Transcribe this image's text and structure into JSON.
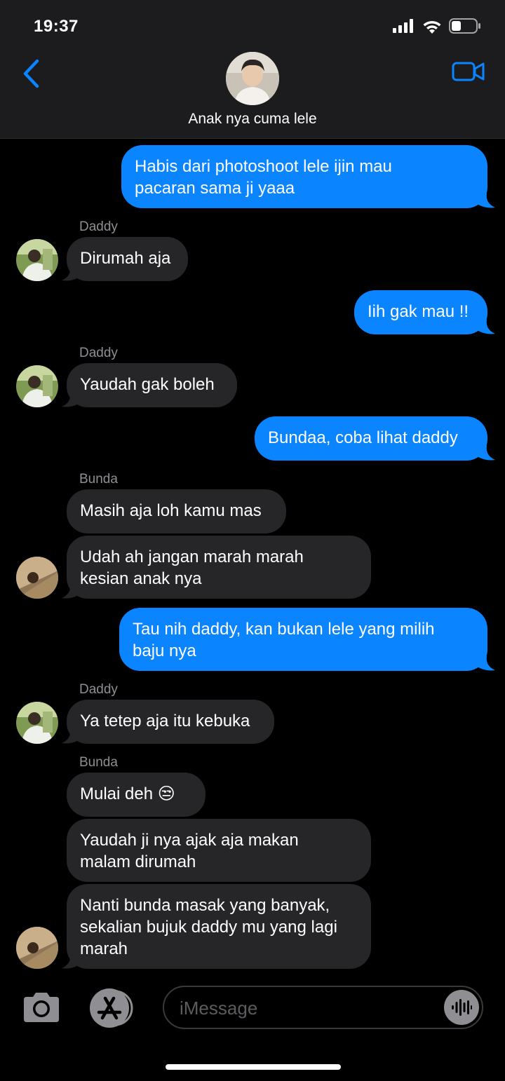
{
  "status_bar": {
    "time": "19:37"
  },
  "header": {
    "contact_name": "Anak nya cuma lele"
  },
  "messages": [
    {
      "id": "m1",
      "direction": "out",
      "text_lines": [
        "Habis dari photoshoot lele ijin mau",
        "pacaran sama ji yaaa"
      ]
    },
    {
      "id": "m2",
      "direction": "in",
      "sender": "Daddy",
      "text_lines": [
        "Dirumah aja"
      ]
    },
    {
      "id": "m3",
      "direction": "out",
      "text_lines": [
        "Iih gak mau !!"
      ]
    },
    {
      "id": "m4",
      "direction": "in",
      "sender": "Daddy",
      "text_lines": [
        "Yaudah gak boleh"
      ]
    },
    {
      "id": "m5",
      "direction": "out",
      "text_lines": [
        "Bundaa, coba lihat daddy"
      ]
    },
    {
      "id": "m6",
      "direction": "in",
      "sender": "Bunda",
      "text_lines": [
        "Masih aja loh kamu mas"
      ]
    },
    {
      "id": "m7",
      "direction": "in",
      "text_lines": [
        "Udah ah jangan marah marah",
        "kesian anak nya"
      ]
    },
    {
      "id": "m8",
      "direction": "out",
      "text_lines": [
        "Tau nih daddy, kan bukan lele yang milih",
        "baju nya"
      ]
    },
    {
      "id": "m9",
      "direction": "in",
      "sender": "Daddy",
      "text_lines": [
        "Ya tetep aja itu kebuka"
      ]
    },
    {
      "id": "m10",
      "direction": "in",
      "sender": "Bunda",
      "text_lines": [
        "Mulai deh 😒"
      ]
    },
    {
      "id": "m11",
      "direction": "in",
      "text_lines": [
        "Yaudah ji nya ajak aja makan",
        "malam dirumah"
      ]
    },
    {
      "id": "m12",
      "direction": "in",
      "text_lines": [
        "Nanti bunda masak yang banyak,",
        "sekalian bujuk daddy mu yang lagi",
        "marah"
      ]
    }
  ],
  "input_bar": {
    "placeholder": "iMessage"
  },
  "icons": {
    "back": "chevron-left-icon",
    "video": "video-camera-icon",
    "camera": "camera-icon",
    "app_store": "app-store-icon",
    "audio": "waveform-icon",
    "signal": "cellular-signal-icon",
    "wifi": "wifi-icon",
    "battery": "battery-icon"
  },
  "colors": {
    "accent": "#0a84ff",
    "outgoing_bubble": "#0a84ff",
    "incoming_bubble": "#262629",
    "header_bg": "#1c1c1e",
    "background": "#000000",
    "sender_label": "#8e8e93"
  }
}
